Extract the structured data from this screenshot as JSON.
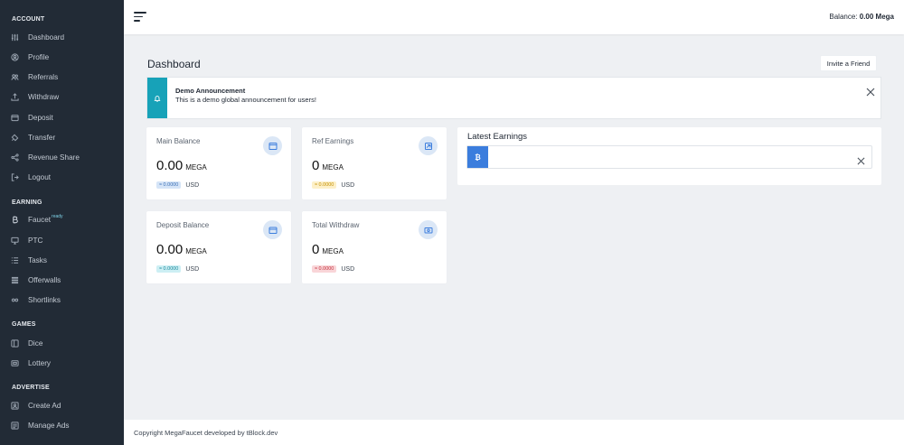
{
  "sidebar": {
    "sections": [
      {
        "title": "ACCOUNT",
        "items": [
          {
            "label": "Dashboard",
            "icon": "sliders-icon"
          },
          {
            "label": "Profile",
            "icon": "user-icon"
          },
          {
            "label": "Referrals",
            "icon": "users-icon"
          },
          {
            "label": "Withdraw",
            "icon": "upload-icon"
          },
          {
            "label": "Deposit",
            "icon": "wallet-icon"
          },
          {
            "label": "Transfer",
            "icon": "transfer-icon"
          },
          {
            "label": "Revenue Share",
            "icon": "share-icon"
          },
          {
            "label": "Logout",
            "icon": "logout-icon"
          }
        ]
      },
      {
        "title": "EARNING",
        "items": [
          {
            "label": "Faucet",
            "badge": "ready",
            "icon": "bitcoin-icon"
          },
          {
            "label": "PTC",
            "icon": "monitor-icon"
          },
          {
            "label": "Tasks",
            "icon": "list-icon"
          },
          {
            "label": "Offerwalls",
            "icon": "grid-icon"
          },
          {
            "label": "Shortlinks",
            "icon": "link-icon"
          }
        ]
      },
      {
        "title": "GAMES",
        "items": [
          {
            "label": "Dice",
            "icon": "dice-icon"
          },
          {
            "label": "Lottery",
            "icon": "ticket-icon"
          }
        ]
      },
      {
        "title": "ADVERTISE",
        "items": [
          {
            "label": "Create Ad",
            "icon": "image-icon"
          },
          {
            "label": "Manage Ads",
            "icon": "layout-icon"
          }
        ]
      }
    ]
  },
  "topbar": {
    "balance_label": "Balance:",
    "balance_value": "0.00 Mega"
  },
  "page": {
    "title": "Dashboard",
    "invite_label": "Invite a Friend"
  },
  "announcement": {
    "title": "Demo Announcement",
    "message": "This is a demo global announcement for users!"
  },
  "cards": [
    {
      "label": "Main Balance",
      "value": "0.00",
      "unit": "MEGA",
      "usd_pill": "≈ 0.0000",
      "usd": "USD",
      "color": "blue"
    },
    {
      "label": "Ref Earnings",
      "value": "0",
      "unit": "MEGA",
      "usd_pill": "≈ 0.0000",
      "usd": "USD",
      "color": "yellow"
    },
    {
      "label": "Deposit Balance",
      "value": "0.00",
      "unit": "MEGA",
      "usd_pill": "≈ 0.0000",
      "usd": "USD",
      "color": "cyan"
    },
    {
      "label": "Total Withdraw",
      "value": "0",
      "unit": "MEGA",
      "usd_pill": "≈ 0.0000",
      "usd": "USD",
      "color": "red"
    }
  ],
  "latest": {
    "title": "Latest Earnings",
    "coin_symbol": "₿"
  },
  "footer": {
    "text": "Copyright MegaFaucet developed by tBlock.dev"
  },
  "colors": {
    "sidebar_bg": "#222b36",
    "accent_blue": "#3b7ddd",
    "announce_teal": "#17a2b8"
  }
}
